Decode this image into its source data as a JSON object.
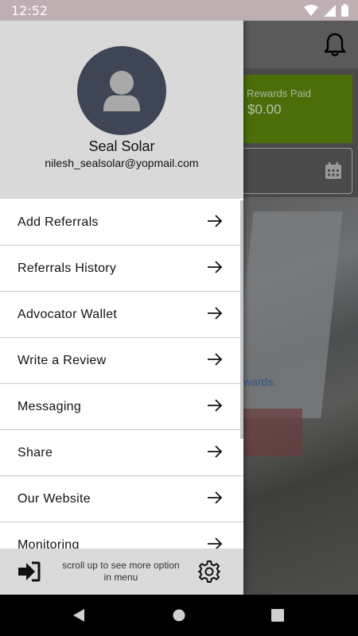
{
  "status_bar": {
    "time": "12:52",
    "icons": [
      "wifi-icon",
      "signal-icon",
      "battery-icon"
    ]
  },
  "background": {
    "rewards_label": "Rewards Paid",
    "rewards_value": "$0.00",
    "link_fragment": "wards."
  },
  "drawer": {
    "user_name": "Seal Solar",
    "user_email": "nilesh_sealsolar@yopmail.com",
    "menu": [
      {
        "label": "Add Referrals"
      },
      {
        "label": "Referrals History"
      },
      {
        "label": "Advocator Wallet"
      },
      {
        "label": "Write a Review"
      },
      {
        "label": "Messaging"
      },
      {
        "label": "Share"
      },
      {
        "label": "Our Website"
      },
      {
        "label": "Monitoring"
      }
    ],
    "footer_hint": "scroll up to see more option in menu"
  },
  "colors": {
    "status_bar": "#bfaeb2",
    "drawer_header": "#d9d9d9",
    "avatar_bg": "#3e4554",
    "rewards_card": "#4b6e0a"
  }
}
